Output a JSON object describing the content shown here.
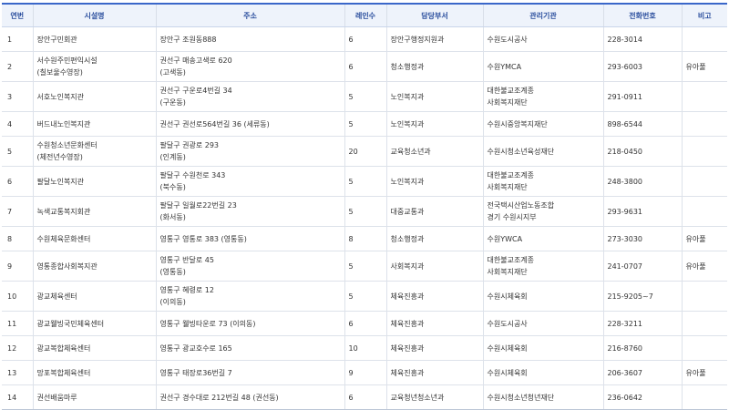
{
  "table": {
    "headers": [
      "연번",
      "시설명",
      "주소",
      "레인수",
      "담당부서",
      "관리기관",
      "전화번호",
      "비고"
    ],
    "rows": [
      {
        "no": "1",
        "name": [
          "장안구민회관"
        ],
        "addr": [
          "장안구 조원동888"
        ],
        "lanes": "6",
        "dept": "장안구행정지원과",
        "org": [
          "수원도시공사"
        ],
        "tel": "228-3014",
        "note": ""
      },
      {
        "no": "2",
        "name": [
          "서수원주민편익시설",
          "(칠보울수영장)"
        ],
        "addr": [
          "권선구 매송고색로 620",
          "(고색동)"
        ],
        "lanes": "6",
        "dept": "청소행정과",
        "org": [
          "수원YMCA"
        ],
        "tel": "293-6003",
        "note": "유아풀"
      },
      {
        "no": "3",
        "name": [
          "서호노인복지관"
        ],
        "addr": [
          "권선구 구운로4번길 34",
          "(구운동)"
        ],
        "lanes": "5",
        "dept": "노인복지과",
        "org": [
          "대한불교조계종",
          "사회복지재단"
        ],
        "tel": "291-0911",
        "note": ""
      },
      {
        "no": "4",
        "name": [
          "버드내노인복지관"
        ],
        "addr": [
          "권선구 권선로564번길 36 (세류동)"
        ],
        "lanes": "5",
        "dept": "노인복지과",
        "org": [
          "수원시중앙복지재단"
        ],
        "tel": "898-6544",
        "note": ""
      },
      {
        "no": "5",
        "name": [
          "수원청소년문화센터",
          "(체전년수영장)"
        ],
        "addr": [
          "팔달구 권광로 293",
          "(인계동)"
        ],
        "lanes": "20",
        "dept": "교육청소년과",
        "org": [
          "수원시청소년육성재단"
        ],
        "tel": "218-0450",
        "note": ""
      },
      {
        "no": "6",
        "name": [
          "팔달노인복지관"
        ],
        "addr": [
          "팔달구 수원천로 343",
          "(북수동)"
        ],
        "lanes": "5",
        "dept": "노인복지과",
        "org": [
          "대한불교조계종",
          "사회복지재단"
        ],
        "tel": "248-3800",
        "note": ""
      },
      {
        "no": "7",
        "name": [
          "녹색교통복지회관"
        ],
        "addr": [
          "팔달구 일월로22번길 23",
          "(화서동)"
        ],
        "lanes": "5",
        "dept": "대중교통과",
        "org": [
          "전국택시산업노동조합",
          "경기 수원시지부"
        ],
        "tel": "293-9631",
        "note": ""
      },
      {
        "no": "8",
        "name": [
          "수원체육문화센터"
        ],
        "addr": [
          "영통구 영통로 383 (영통동)"
        ],
        "lanes": "8",
        "dept": "청소행정과",
        "org": [
          "수원YWCA"
        ],
        "tel": "273-3030",
        "note": "유아풀"
      },
      {
        "no": "9",
        "name": [
          "영통종합사회복지관"
        ],
        "addr": [
          "영통구 반달로 45",
          "(영통동)"
        ],
        "lanes": "5",
        "dept": "사회복지과",
        "org": [
          "대한불교조계종",
          "사회복지재단"
        ],
        "tel": "241-0707",
        "note": "유아풀"
      },
      {
        "no": "10",
        "name": [
          "광교체육센터"
        ],
        "addr": [
          "영통구 혜령로 12",
          "(이의동)"
        ],
        "lanes": "5",
        "dept": "체육진흥과",
        "org": [
          "수원시체육회"
        ],
        "tel": "215-9205~7",
        "note": ""
      },
      {
        "no": "11",
        "name": [
          "광교웰빙국민체육센터"
        ],
        "addr": [
          "영통구 웰빙타운로 73 (이의동)"
        ],
        "lanes": "6",
        "dept": "체육진흥과",
        "org": [
          "수원도시공사"
        ],
        "tel": "228-3211",
        "note": ""
      },
      {
        "no": "12",
        "name": [
          "광교복합체육센터"
        ],
        "addr": [
          "영통구 광교호수로 165"
        ],
        "lanes": "10",
        "dept": "체육진흥과",
        "org": [
          "수원시체육회"
        ],
        "tel": "216-8760",
        "note": ""
      },
      {
        "no": "13",
        "name": [
          "망포복합체육센터"
        ],
        "addr": [
          "영통구 태장로36번길 7"
        ],
        "lanes": "9",
        "dept": "체육진흥과",
        "org": [
          "수원시체육회"
        ],
        "tel": "206-3607",
        "note": "유아풀"
      },
      {
        "no": "14",
        "name": [
          "권선배움마루"
        ],
        "addr": [
          "권선구 경수대로 212번길 48 (권선동)"
        ],
        "lanes": "6",
        "dept": "교육청년청소년과",
        "org": [
          "수원시청소년청년재단"
        ],
        "tel": "236-0642",
        "note": ""
      }
    ]
  }
}
